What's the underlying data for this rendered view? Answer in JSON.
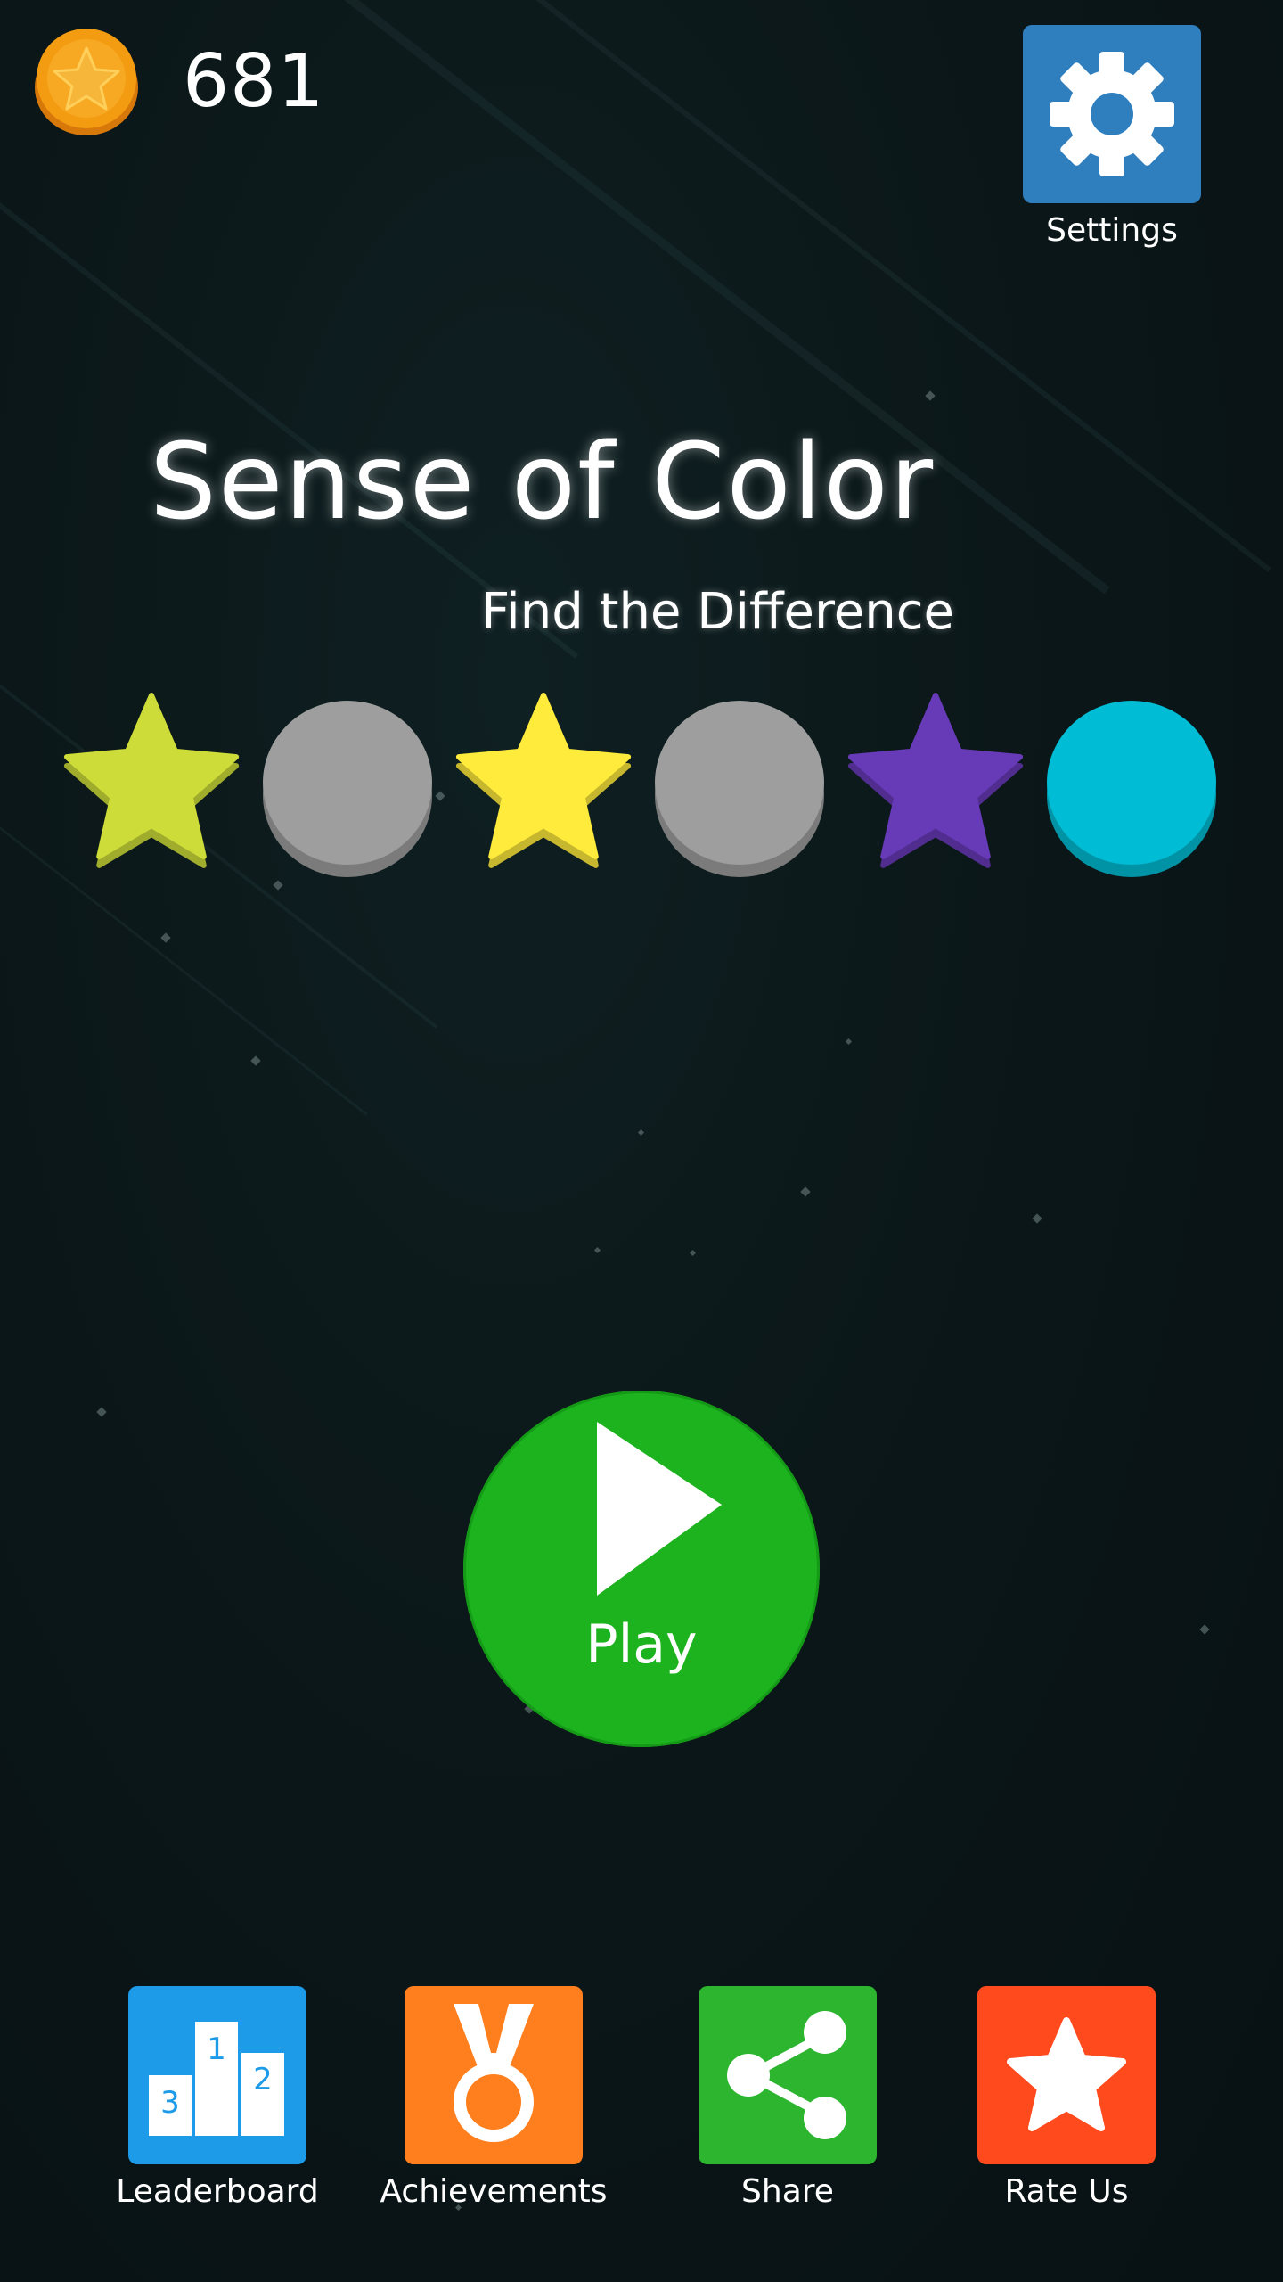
{
  "hud": {
    "coins": "681"
  },
  "settings": {
    "label": "Settings",
    "color": "#2f7fbf"
  },
  "title": "Sense of Color",
  "subtitle": "Find the Difference",
  "shapes": [
    {
      "shape": "star",
      "color": "#cddc39"
    },
    {
      "shape": "circle",
      "color": "#9e9e9e"
    },
    {
      "shape": "star",
      "color": "#ffeb3b"
    },
    {
      "shape": "circle",
      "color": "#9e9e9e"
    },
    {
      "shape": "star",
      "color": "#673ab7"
    },
    {
      "shape": "circle",
      "color": "#00bcd4"
    }
  ],
  "play": {
    "label": "Play",
    "color": "#1db31f"
  },
  "menu": [
    {
      "label": "Leaderboard",
      "icon": "podium-icon",
      "color": "#1e9be8"
    },
    {
      "label": "Achievements",
      "icon": "medal-icon",
      "color": "#ff7f1f"
    },
    {
      "label": "Share",
      "icon": "share-icon",
      "color": "#2db52f"
    },
    {
      "label": "Rate Us",
      "icon": "star-icon",
      "color": "#ff4a1e"
    }
  ],
  "leaderboard_icon": {
    "ranks": [
      "1",
      "2",
      "3"
    ]
  }
}
